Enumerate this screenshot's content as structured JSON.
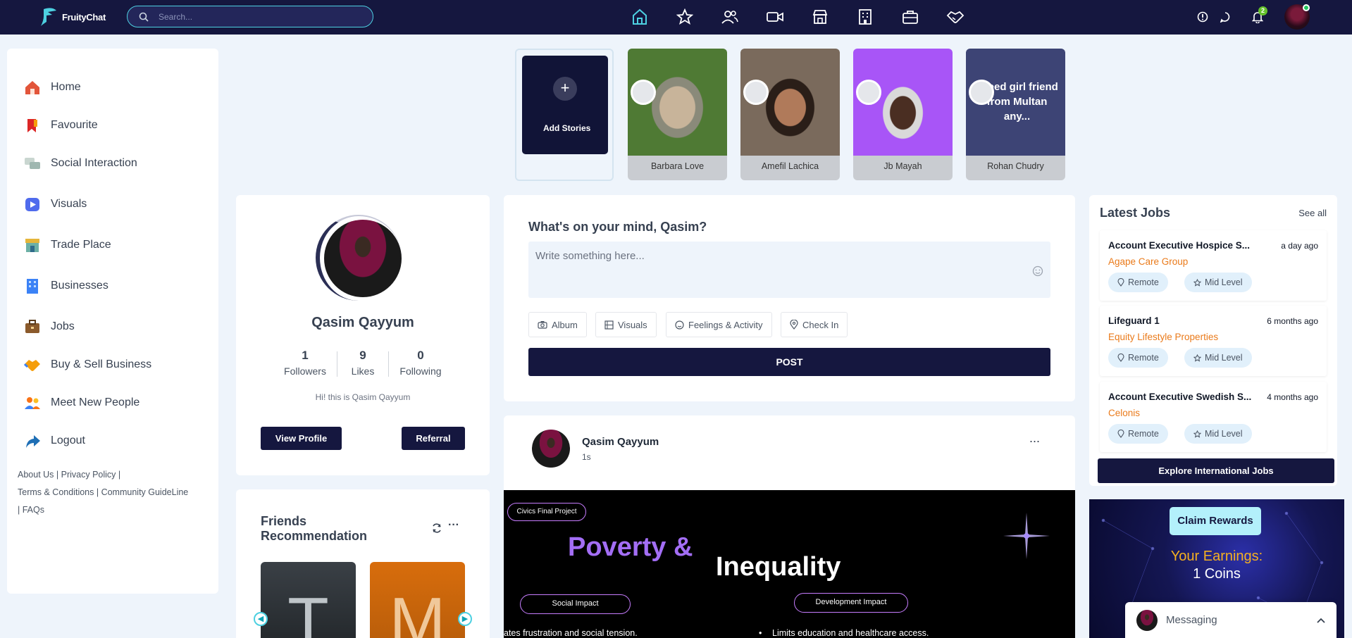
{
  "app": {
    "logo_text": "FruityChat"
  },
  "search": {
    "placeholder": "Search..."
  },
  "topnav": [
    "home-icon",
    "star-icon",
    "people-icon",
    "video-icon",
    "store-icon",
    "building-icon",
    "briefcase-icon",
    "handshake-icon"
  ],
  "topright": {
    "notification_count": "2"
  },
  "sidebar": {
    "items": [
      {
        "label": "Home",
        "icon": "home-icon",
        "color": "#e2553a"
      },
      {
        "label": "Favourite",
        "icon": "bookmark-icon",
        "color": "#dc2626"
      },
      {
        "label": "Social Interaction",
        "icon": "chat-bubbles-icon",
        "color": "#9fb7b0"
      },
      {
        "label": "Visuals",
        "icon": "visuals-icon",
        "color": "#4f6bed"
      },
      {
        "label": "Trade Place",
        "icon": "shop-icon",
        "color": "#e5b53a"
      },
      {
        "label": "Businesses",
        "icon": "office-icon",
        "color": "#3b82f6"
      },
      {
        "label": "Jobs",
        "icon": "suitcase-icon",
        "color": "#8b5a2b"
      },
      {
        "label": "Buy & Sell Business",
        "icon": "deal-icon",
        "color": "#f59e0b"
      },
      {
        "label": "Meet New People",
        "icon": "people-icon",
        "color": "#f97316"
      },
      {
        "label": "Logout",
        "icon": "logout-icon",
        "color": "#1e6fb5"
      }
    ],
    "links": {
      "about": "About Us",
      "privacy": "Privacy Policy",
      "terms": "Terms & Conditions",
      "guideline": "Community GuideLine",
      "faqs": "FAQs"
    }
  },
  "stories": {
    "add_label": "Add Stories",
    "items": [
      {
        "name": "Barbara Love",
        "bg": "#6b8f4a"
      },
      {
        "name": "Amefil Lachica",
        "bg": "#6a5a4c"
      },
      {
        "name": "Jb Mayah",
        "bg": "#a855f7"
      },
      {
        "name": "Rohan Chudry",
        "bg": "#3d4475",
        "text": "I need girl friend from Multan any..."
      }
    ]
  },
  "profile": {
    "name": "Qasim Qayyum",
    "stats": [
      {
        "value": "1",
        "label": "Followers"
      },
      {
        "value": "9",
        "label": "Likes"
      },
      {
        "value": "0",
        "label": "Following"
      }
    ],
    "bio": "Hi! this is Qasim Qayyum",
    "view_profile": "View Profile",
    "referral": "Referral"
  },
  "friends": {
    "title": "Friends Recommendation",
    "tiles": [
      {
        "letter": "T",
        "bg": "#3a4046"
      },
      {
        "letter": "M",
        "bg": "#d86d0c"
      }
    ]
  },
  "composer": {
    "title": "What's on your mind, Qasim?",
    "placeholder": "Write something here...",
    "actions": [
      "Album",
      "Visuals",
      "Feelings & Activity",
      "Check In"
    ],
    "post_label": "POST"
  },
  "post": {
    "author": "Qasim Qayyum",
    "time": "1s",
    "more": "...",
    "image": {
      "tag": "Civics Final Project",
      "title_1": "Poverty &",
      "title_2": "Inequality",
      "pill_1": "Social Impact",
      "pill_2": "Development Impact",
      "line_1": "ates frustration and social tension.",
      "line_2": "Limits education and healthcare access."
    }
  },
  "jobs": {
    "title": "Latest Jobs",
    "see_all": "See all",
    "items": [
      {
        "title": "Account Executive Hospice S...",
        "time": "a day ago",
        "company": "Agape Care Group",
        "location": "Remote",
        "level": "Mid Level"
      },
      {
        "title": "Lifeguard 1",
        "time": "6 months ago",
        "company": "Equity Lifestyle Properties",
        "location": "Remote",
        "level": "Mid Level"
      },
      {
        "title": "Account Executive Swedish S...",
        "time": "4 months ago",
        "company": "Celonis",
        "location": "Remote",
        "level": "Mid Level"
      }
    ],
    "explore": "Explore International Jobs"
  },
  "rewards": {
    "claim": "Claim Rewards",
    "earnings_label": "Your Earnings:",
    "earnings_value": "1 Coins"
  },
  "messaging": {
    "label": "Messaging"
  },
  "colors": {
    "navy": "#15173f",
    "accent": "#4dd0e1",
    "orange": "#ea7a1a",
    "bg": "#eef4fb"
  }
}
